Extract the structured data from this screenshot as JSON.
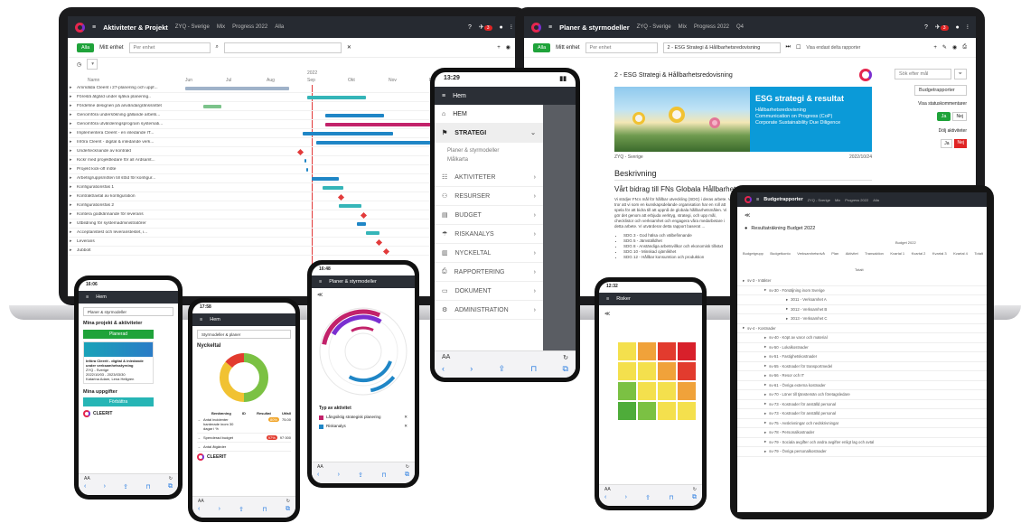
{
  "laptop_left": {
    "app_title": "Aktiviteter & Projekt",
    "crumbs": [
      "ZYQ - Sverige",
      "Mix",
      "Progress 2022",
      "Alla"
    ],
    "badge": "3",
    "filter_btn": "Alla",
    "filter_label": "Mitt enhet",
    "filter_placeholder": "Per enhet",
    "name_header": "Namn",
    "year": "2022",
    "months": [
      "Jun",
      "Jul",
      "Aug",
      "Sep",
      "Okt",
      "Nov",
      "Dec",
      "Jan"
    ],
    "rows": [
      "Ammälda Cleerit i 27-planering och uppf...",
      "Föreslå åtgärd under själva planering..",
      "Fördefine designen på användargränssnittet",
      "Genomföra undersökning gällande arbets...",
      "Genomföra utvärderingsprogram systemati...",
      "Implementera Cleerit - en inledande IT...",
      "Införa Cleerit - digital & inledande verk...",
      "Undertecknande av kontrakt",
      "Kickr med projektledare för all Ärdsamt...",
      "Projekt kick-off möte",
      "Arbetsgruppsmöten till stöd för konfigur...",
      "Konfigurationsfas 1",
      "Kontrakt/avtal av konfiguration",
      "Konfigurationsfas 2",
      "Kontera godkännande för leverans",
      "Utbildning för systemadministratörer",
      "Acceptanstest och leveranstestet, i...",
      "Leverans",
      "Jubbolt"
    ]
  },
  "laptop_right": {
    "app_title": "Planer & styrmodeller",
    "crumbs": [
      "ZYQ - Sverige",
      "Mix",
      "Progress 2022",
      "Q4"
    ],
    "badge": "3",
    "filter_btn": "Alla",
    "filter_label": "Mitt enhet",
    "filter_placeholder": "Per enhet",
    "plan_select": "2 - ESG Strategi & Hållbarhetsredovisning",
    "show_ended": "Visa endast delta rapporter",
    "doc_title": "2 - ESG Strategi & Hållbarhetsredovisning",
    "banner_title": "ESG strategi & resultat",
    "banner_bullets": [
      "Hållbarhetsredovisning",
      "Communication on Progress (CoP)",
      "Corporate Sustainability Due Diligence"
    ],
    "org": "ZYQ - Sverige",
    "date": "2022/10/24",
    "section": "Beskrivning",
    "heading": "Vårt bidrag till FNs Globala Hållbarhetsmål",
    "paragraph": "Vi stödjer FN:s mål för hållbar utveckling (SDG) i deras arbete. Vi tror att vi som en kunskapsdelande organisation har en roll att spela för att bidra till att uppnå de globala hållbarhetsmålen. Vi gör det genom att erbjuda verktyg, strategi, och upp mål, checklistor och verksamhet och engagera våra medarbetare i detta arbete. Vi utvärderar detta rapport baserat ...",
    "list": [
      "SDG 3 - God hälsa och välbefinnande",
      "SDG 5 - Jämställdhet",
      "SDG 8 - Anständiga arbetsvillkor och ekonomisk tillväxt",
      "SDG 10 - Minskad ojämlikhet",
      "SDG 12 - Hållbar konsumtion och produktion"
    ],
    "search_placeholder": "Sök efter mål",
    "budget_btn": "Budgetrapporter",
    "status_label": "Visa statuskommentarer",
    "hidden_label": "Dölj aktiviteter",
    "ja": "Ja",
    "nej": "Nej"
  },
  "phone_menu": {
    "time": "13:29",
    "header": "Hem",
    "items": [
      {
        "icon": "home-icon",
        "label": "HEM"
      },
      {
        "icon": "strategy-icon",
        "label": "STRATEGI"
      },
      {
        "icon": "activities-icon",
        "label": "AKTIVITETER"
      },
      {
        "icon": "resources-icon",
        "label": "RESURSER"
      },
      {
        "icon": "budget-icon",
        "label": "BUDGET"
      },
      {
        "icon": "risk-icon",
        "label": "RISKANALYS"
      },
      {
        "icon": "kpi-icon",
        "label": "NYCKELTAL"
      },
      {
        "icon": "report-icon",
        "label": "RAPPORTERING"
      },
      {
        "icon": "document-icon",
        "label": "DOKUMENT"
      },
      {
        "icon": "admin-icon",
        "label": "ADMINISTRATION"
      }
    ],
    "sub_items": [
      "Planer & styrmodeller",
      "Målkarta"
    ],
    "url_left": "AA",
    "url_right": "↻"
  },
  "phone_home": {
    "time": "16:06",
    "header": "Hem",
    "select": "Planer & styrmodeller",
    "section1": "Mina projekt & aktiviteter",
    "planned": "Planerad",
    "card_title": "Införa Cleerit - digital & inledande under verksamhetsstyrning",
    "card_org": "ZYQ - Sverige",
    "card_dates": "2022/10/03 - 2023/03/30",
    "card_people": "Katarina Adam, Lena Hellgren",
    "section2": "Mina uppgifter",
    "done": "Förbättra",
    "logo": "CLEERIT",
    "url_left": "AA"
  },
  "phone_kpi": {
    "time": "17:58",
    "header": "Hem",
    "select": "Styrmodeller & planer",
    "section": "Nyckeltal",
    "cols": [
      "Benämning",
      "ID",
      "Resultat",
      "Utfall"
    ],
    "rows": [
      {
        "name": "Antal incidenter hanterade inom 30 dagar i %",
        "result": "80%",
        "value": "75.00"
      },
      {
        "name": "Spenderad budget",
        "result": "97%",
        "value": "97 000"
      },
      {
        "name": "Antal åtgärder",
        "result": "",
        "value": ""
      }
    ],
    "logo": "CLEERIT",
    "url_left": "AA"
  },
  "phone_planer": {
    "time": "16:48",
    "header": "Planer & styrmodeller",
    "legend_title": "Typ av aktivitet",
    "legend": [
      "Långsiktig strategisk planering",
      "Riskanalys"
    ],
    "legend_colors": [
      "#c2226a",
      "#1f86c6"
    ],
    "url_left": "AA"
  },
  "phone_risk": {
    "time": "12:32",
    "header": "Risker",
    "url_left": "AA",
    "matrix": [
      [
        "#f4e04d",
        "#f0a23a",
        "#e23b2e",
        "#d8202b"
      ],
      [
        "#f4e04d",
        "#f4e04d",
        "#f0a23a",
        "#e23b2e"
      ],
      [
        "#7bc143",
        "#f4e04d",
        "#f4e04d",
        "#f0a23a"
      ],
      [
        "#4eac3a",
        "#7bc143",
        "#f4e04d",
        "#f4e04d"
      ]
    ]
  },
  "tablet": {
    "app_title": "Budgetrapporter",
    "crumbs": [
      "ZYQ - Sverige",
      "Mix",
      "Progress 2022",
      "Alla"
    ],
    "report_title": "Resultaträkning Budget 2022",
    "header_row": [
      "Budgetgrupp",
      "Budgetkonto",
      "Verksamhetsnivå",
      "Plan",
      "Aktivitet",
      "Transaktion",
      "Kvartal 1",
      "Kvartal 2",
      "Kvartal 3",
      "Kvartal 4",
      "Totalt"
    ],
    "budget_label": "Budget 2022",
    "total_label": "Totalt",
    "rows": [
      "sv-3 - Intäkter",
      "sv-30 - Försäljning inom Sverige",
      "3011 - Verksamhet A",
      "3012 - Verksamhet B",
      "3013 - Verksamhet C",
      "sv-4 - Kostnader",
      "sv-40 - Köpt av varor och material",
      "sv-50 - Lokalkostnader",
      "sv-51 - Fastighetskostnader",
      "sv-55 - Kostnader för transportmedel",
      "sv-56 - Resor och IT",
      "sv-61 - Övriga externa kostnader",
      "sv-70 - Löner till tjänstemän och företagsledare",
      "sv-73 - Kostnader för anställd personal",
      "sv-73 - Kostnader för anställd personal",
      "sv-75 - Avskrivningar och nedskrivningar",
      "sv-78 - Personalkostnader",
      "sv-79 - Sociala avgifter och andra avgifter enligt lag och avtal",
      "sv-79 - Övriga personalkostnader"
    ]
  }
}
